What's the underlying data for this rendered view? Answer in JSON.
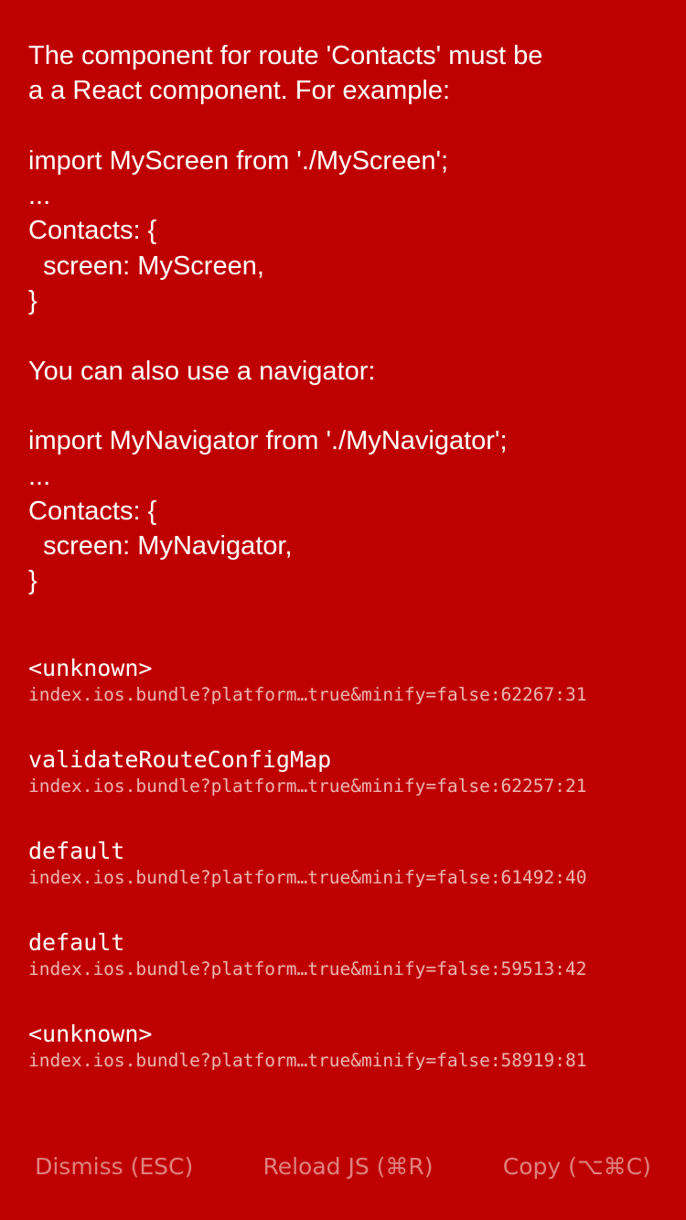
{
  "error": {
    "message": "The component for route 'Contacts' must be\na a React component. For example:\n\nimport MyScreen from './MyScreen';\n...\nContacts: {\n  screen: MyScreen,\n}\n\nYou can also use a navigator:\n\nimport MyNavigator from './MyNavigator';\n...\nContacts: {\n  screen: MyNavigator,\n}"
  },
  "stack": [
    {
      "method": "<unknown>",
      "location": "index.ios.bundle?platform…true&minify=false:62267:31"
    },
    {
      "method": "validateRouteConfigMap",
      "location": "index.ios.bundle?platform…true&minify=false:62257:21"
    },
    {
      "method": "default",
      "location": "index.ios.bundle?platform…true&minify=false:61492:40"
    },
    {
      "method": "default",
      "location": "index.ios.bundle?platform…true&minify=false:59513:42"
    },
    {
      "method": "<unknown>",
      "location": "index.ios.bundle?platform…true&minify=false:58919:81"
    }
  ],
  "buttons": {
    "dismiss": "Dismiss (ESC)",
    "reload": "Reload JS (⌘R)",
    "copy": "Copy (⌥⌘C)"
  },
  "colors": {
    "background": "#bf0000",
    "text": "#ffffff"
  }
}
